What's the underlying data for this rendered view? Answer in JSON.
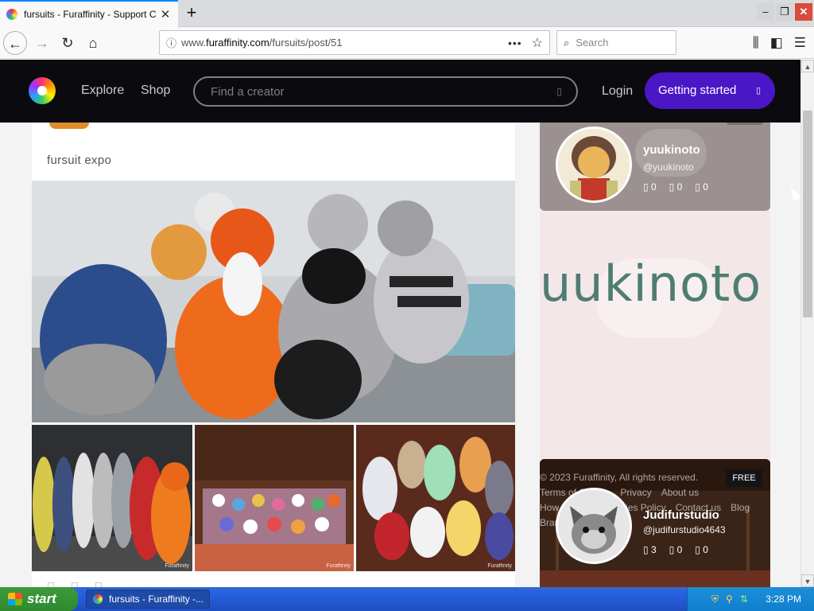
{
  "browser": {
    "tab_title": "fursuits - Furaffinity - Support Cre",
    "tab_close": "✕",
    "new_tab": "+",
    "win_minimize": "–",
    "win_restore": "❐",
    "win_close": "✕",
    "url_prefix": "www.",
    "url_domain": "furaffinity.com",
    "url_path": "/fursuits/post/51",
    "url_menu": "•••",
    "url_star": "☆",
    "search_placeholder": "Search",
    "back": "←",
    "forward": "→",
    "reload": "↻",
    "home": "⌂"
  },
  "site": {
    "nav": [
      "Explore",
      "Shop"
    ],
    "find_placeholder": "Find a creator",
    "search_glyph": "▯",
    "login": "Login",
    "getting_started": "Getting started",
    "cta_glyph": "▯"
  },
  "post": {
    "caption": "fursuit expo",
    "watermark": "Furaffinity"
  },
  "sidebar": {
    "creators": [
      {
        "name": "yuukinoto",
        "handle": "@yuukinoto",
        "stats": [
          "0",
          "0",
          "0"
        ],
        "banner_text": "uukinoto"
      },
      {
        "name": "Judifurstudio",
        "handle": "@judifurstudio4643",
        "stats": [
          "3",
          "0",
          "0"
        ],
        "badge": "FREE"
      }
    ],
    "stat_glyph": "▯"
  },
  "footer": {
    "copyright": "© 2023 Furaffinity, All rights reserved.",
    "links_row1": [
      "Terms of Service",
      "Privacy",
      "About us"
    ],
    "links_row2": [
      "How it works",
      "Cookies Policy",
      "Contact us",
      "Blog"
    ],
    "links_row3": [
      "Brand"
    ]
  },
  "taskbar": {
    "start": "start",
    "window_title": "fursuits - Furaffinity -...",
    "time": "3:28 PM"
  },
  "colors": {
    "site_header_bg": "#0a0a0f",
    "cta_purple": "#4b16c6",
    "banner_text": "#4f7d73",
    "taskbar_blue": "#245edc"
  }
}
